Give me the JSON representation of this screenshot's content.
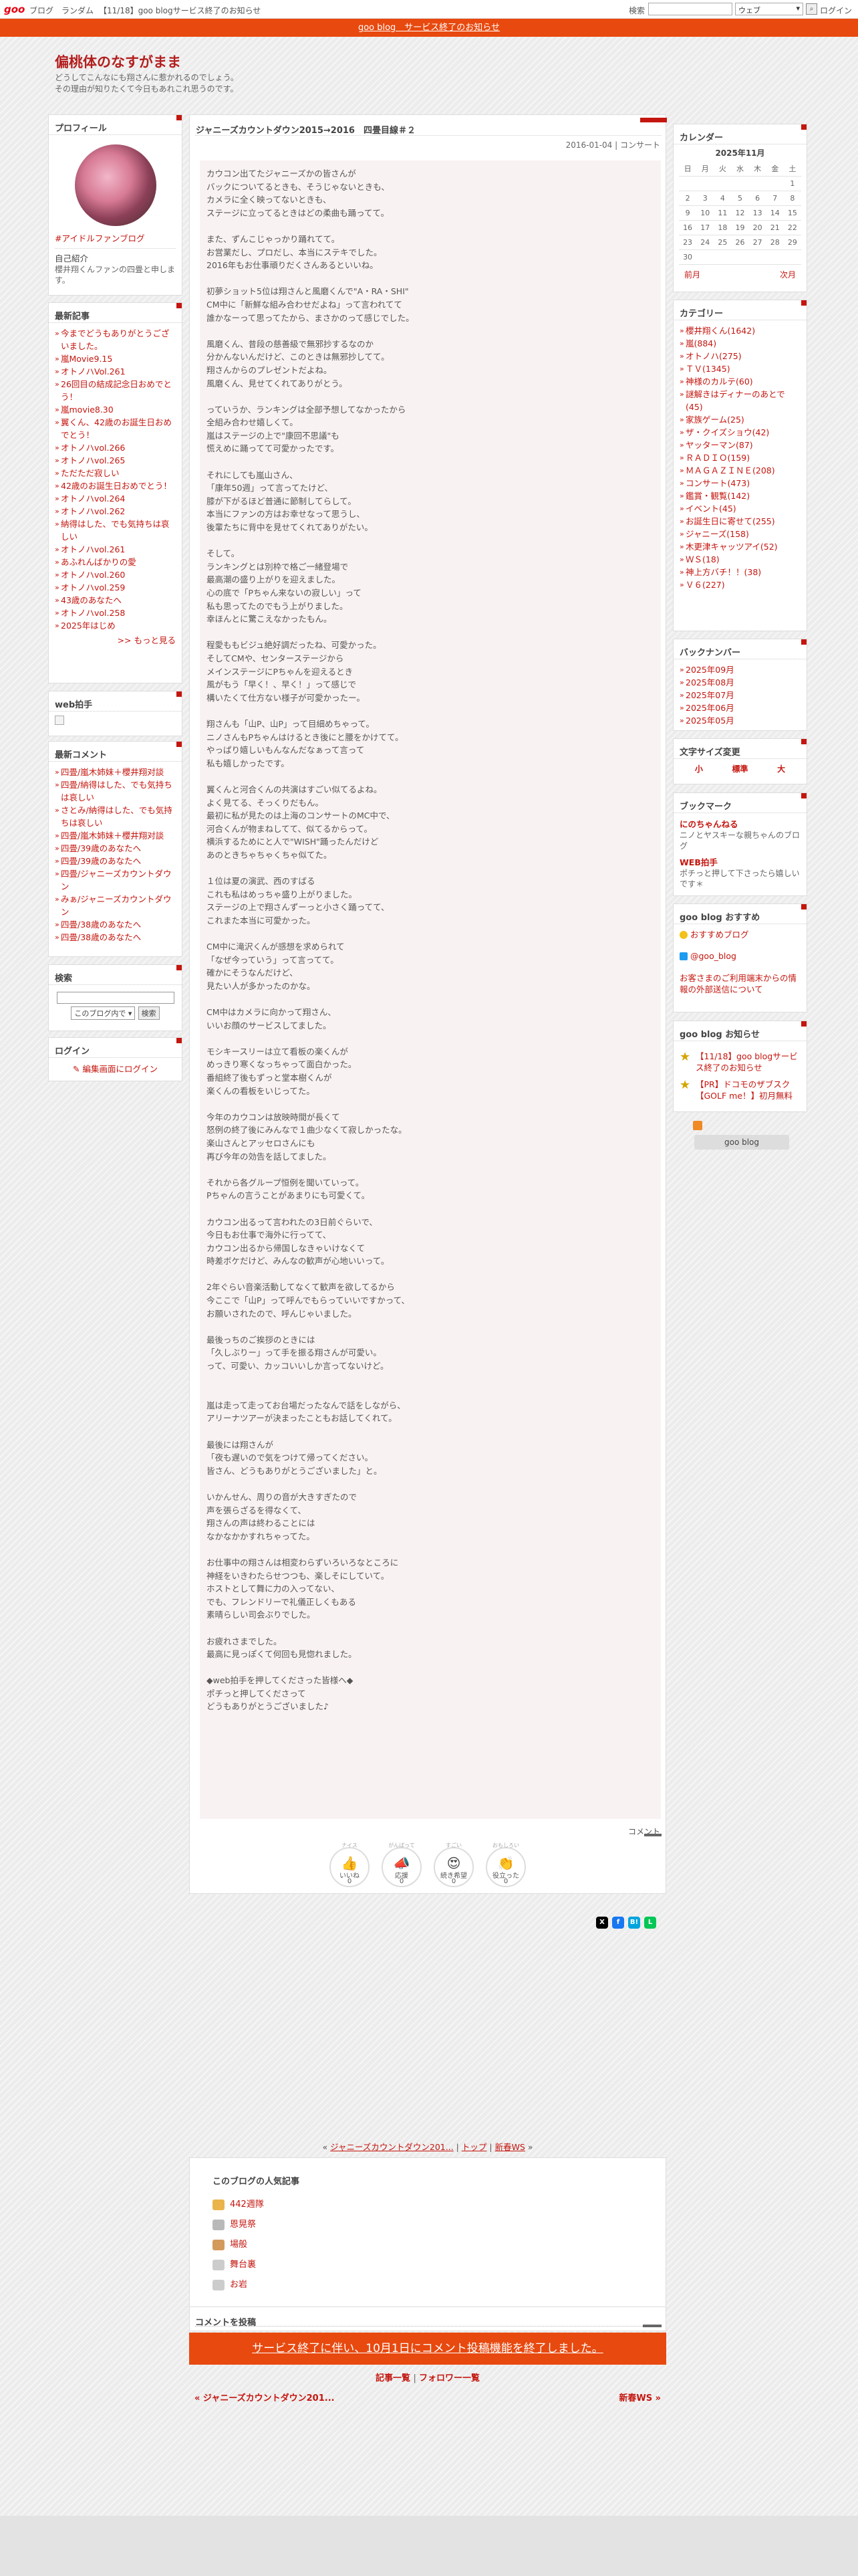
{
  "topbar": {
    "logo": "goo",
    "links": [
      "ブログ",
      "ランダム",
      "【11/18】goo blogサービス終了のお知らせ"
    ],
    "search_label": "検索",
    "search_select": "ウェブ",
    "login": "ログイン"
  },
  "notice": "goo blog　サービス終了のお知らせ",
  "blog": {
    "title": "偏桃体のなすがまま",
    "description": [
      "どうしてこんなにも翔さんに惹かれるのでしょう。",
      "その理由が知りたくて今日もあれこれ思うのです。"
    ]
  },
  "left": {
    "profile": {
      "header": "プロフィール",
      "category_link": "#アイドルファンブログ",
      "intro_label": "自己紹介",
      "intro": "櫻井翔くんファンの四畳と申します。"
    },
    "recent": {
      "header": "最新記事",
      "items": [
        "今までどうもありがとうございました。",
        "嵐Movie9.15",
        "オトノハVol.261",
        "26回目の結成記念日おめでとう！",
        "嵐movie8.30",
        "翼くん、42歳のお誕生日おめでとう！",
        "オトノハvol.266",
        "オトノハvol.265",
        "ただただ寂しい",
        "42歳のお誕生日おめでとう！",
        "オトノハvol.264",
        "オトノハvol.262",
        "納得はした、でも気持ちは哀しい",
        "オトノハvol.261",
        "あふれんばかりの愛",
        "オトノハvol.260",
        "オトノハvol.259",
        "43歳のあなたへ",
        "オトノハvol.258",
        "2025年はじめ"
      ],
      "more": ">> もっと見る"
    },
    "web_clap": {
      "header": "web拍手"
    },
    "recent_comments": {
      "header": "最新コメント",
      "items": [
        "四畳/嵐木姉妹＋櫻井翔对談",
        "四畳/納得はした、でも気持ちは哀しい",
        "さとみ/納得はした、でも気持ちは哀しい",
        "四畳/嵐木姉妹＋櫻井翔对談",
        "四畳/39歳のあなたへ",
        "四畳/39歳のあなたへ",
        "四畳/ジャニーズカウントダウン",
        "みぁ/ジャニーズカウントダウン",
        "四畳/38歳のあなたへ",
        "四畳/38歳のあなたへ"
      ]
    },
    "search": {
      "header": "検索",
      "scope": "このブログ内で",
      "button": "検索"
    },
    "login": {
      "header": "ログイン",
      "link": "編集画面にログイン"
    }
  },
  "entry": {
    "title": "ジャニーズカウントダウン2015→2016　四畳目線＃２",
    "meta": "2016-01-04 | コンサート",
    "body": "カウコン出てたジャニーズかの皆さんが\nバックについてるときも、そうじゃないときも、\nカメラに全く映ってないときも、\nステージに立ってるときはどの柔曲も踊ってて。\n\nまた、ずんこじゃっかり踊れてて。\nお営業だし、プロだし、本当にステキでした。\n2016年もお仕事頑りだくさんあるといいね。\n\n初夢ショット5位は翔さんと風磨くんで\"A・RA・SHI\"\nCM中に「新鮮な組み合わせだよね」って言われてて\n誰かなーって思ってたから、まさかのって感じでした。\n\n風磨くん、昔段の慈善級で無邪抄するなのか\n分かんないんだけど、このときは無邪抄してて。\n翔さんからのプレゼントだよね。\n風磨くん、見せてくれてありがとう。\n\nっていうか、ランキングは全部予想してなかったから\n全組み合わせ嬉しくて。\n嵐はステージの上で\"康回不思議\"も\n慌えめに踊ってて可愛かったです。\n\nそれにしても嵐山さん、\n「康年50週」って言ってたけど、\n膝が下がるほど普通に節制してらして。\n本当にファンの方はお幸せなって思うし、\n後輩たちに背中を見せてくれてありがたい。\n\nそして。\nランキングとは別枠で格ご一緒登場で\n最高潮の盛り上がりを迎えました。\n心の底で「Pちゃん来ないの寂しい」って\n私も思ってたのでもう上がりました。\n幸ほんとに驚こえなかったもん。\n\n程愛ももビジュ絶好調だったね、可愛かった。\nそしてCMや、センターステージから\nメインステージにPちゃんを迎えるとき\n風がもう「早く！、早く！」って感じで\n構いたくて仕方ない様子が可愛かったー。\n\n翔さんも「山P、山P」って目細めちゃって。\nニノさんもPちゃんはけるとき後にと腰をかけてて。\nやっぱり嬉しいもんなんだなぁって言って\n私も嬉しかったです。\n\n翼くんと河合くんの共演はすごい似てるよね。\nよく見てる、そっくりだもん。\n最初に私が見たのは上海のコンサートのMC中で、\n河合くんが物まねしてて、似てるからって。\n横浜するためにと人で\"WISH\"踊ったんだけど\nあのときちゃちゃくちゃ似てた。\n\n１位は夏の演武、西のすばる\nこれも私はめっちゃ盛り上がりました。\nステージの上で翔さんずーっと小さく踊ってて、\nこれまた本当に可愛かった。\n\nCM中に滝沢くんが感想を求められて\n「なぜ今っていう」って言ってて。\n確かにそうなんだけど、\n見たい人が多かったのかな。\n\nCM中はカメラに向かって翔さん、\nいいお顔のサービスしてました。\n\nモシキースリーは立て看板の楽くんが\nめっきり寒くなっちゃって面白かった。\n番組終了後もずっと堂本樹くんが\n楽くんの看板をいじってた。\n\n今年のカウコンは放映時間が長くて\n怒例の終了後にみんなで１曲少なくて寂しかったな。\n楽山さんとアッセロさんにも\n再び今年の効告を話してました。\n\nそれから各グループ恒例を聞いていって。\nPちゃんの言うことがあまりにも可愛くて。\n\nカウコン出るって言われたの3日前ぐらいで、\n今日もお仕事で海外に行ってて、\nカウコン出るから帰国しなきゃいけなくて\n時差ボケだけど、みんなの歓声が心地いいって。\n\n2年ぐらい音楽活動してなくて歓声を欲してるから\n今ここで「山P」って呼んでもらっていいですかって、\nお願いされたので、呼んじゃいました。\n\n最後っちのご挨拶のときには\n「久しぶりー」って手を振る翔さんが可愛い。\nって、可愛い、カッコいいしか言ってないけど。\n\n\n嵐は走って走ってお台場だったなんで話をしながら、\nアリーナツアーが決まったこともお話してくれて。\n\n最後には翔さんが\n「夜も遅いので気をつけて帰ってください。\n皆さん、どうもありがとうございました」と。\n\nいかんせん、周りの音が大きすぎたので\n声を張らざるを得なくて、\n翔さんの声は終わることには\nなかなかかすれちゃってた。\n\nお仕事中の翔さんは相変わらずいろいろなところに\n神経をいきわたらせつつも、楽しそにしていて。\nホストとして舞に力の入ってない、\nでも、フレンドリーで礼儀正しくもある\n素晴らしい司会ぶりでした。\n\nお疲れさまでした。\n最高に見っぽくて何回も見惚れました。\n\n◆web拍手を押してくださった皆様へ◆\nポチっと押してくださって\nどうもありがとうございました♪",
    "comment_link": "コメント",
    "reactions": [
      {
        "small": "ナイス",
        "label": "いいね",
        "count": "0",
        "icon": "thumbs-up-icon",
        "glyph": "👍"
      },
      {
        "small": "がんばって",
        "label": "応援",
        "count": "0",
        "icon": "megaphone-icon",
        "glyph": "📣"
      },
      {
        "small": "すごい",
        "label": "続き希望",
        "count": "0",
        "icon": "star-eyes-icon",
        "glyph": "😍"
      },
      {
        "small": "おもしろい",
        "label": "役立った",
        "count": "0",
        "icon": "clap-icon",
        "glyph": "👏"
      }
    ],
    "share": [
      {
        "label": "X",
        "color": "#000000"
      },
      {
        "label": "f",
        "color": "#1877f2"
      },
      {
        "label": "B!",
        "color": "#00a4de"
      },
      {
        "label": "L",
        "color": "#06c755"
      }
    ]
  },
  "right": {
    "calendar": {
      "header": "カレンダー",
      "month": "2025年11月",
      "weekdays": [
        "日",
        "月",
        "火",
        "水",
        "木",
        "金",
        "土"
      ],
      "weeks": [
        [
          "",
          "",
          "",
          "",
          "",
          "",
          "1"
        ],
        [
          "2",
          "3",
          "4",
          "5",
          "6",
          "7",
          "8"
        ],
        [
          "9",
          "10",
          "11",
          "12",
          "13",
          "14",
          "15"
        ],
        [
          "16",
          "17",
          "18",
          "19",
          "20",
          "21",
          "22"
        ],
        [
          "23",
          "24",
          "25",
          "26",
          "27",
          "28",
          "29"
        ],
        [
          "30",
          "",
          "",
          "",
          "",
          "",
          ""
        ]
      ],
      "prev": "前月",
      "next": "次月"
    },
    "categories": {
      "header": "カテゴリー",
      "items": [
        "櫻井翔くん(1642)",
        "嵐(884)",
        "オトノハ(275)",
        "ＴＶ(1345)",
        "神様のカルテ(60)",
        "謎解きはディナーのあとで(45)",
        "家族ゲーム(25)",
        "ザ・クイズショウ(42)",
        "ヤッターマン(87)",
        "ＲＡＤＩＯ(159)",
        "ＭＡＧＡＺＩＮＥ(208)",
        "コンサート(473)",
        "鑑賞・観覧(142)",
        "イベント(45)",
        "お誕生日に寄せて(255)",
        "ジャニーズ(158)",
        "木更津キャッツアイ(52)",
        "ＷＳ(18)",
        "神上方バチ！！(38)",
        "Ｖ６(227)"
      ]
    },
    "backnumber": {
      "header": "バックナンバー",
      "items": [
        "2025年09月",
        "2025年08月",
        "2025年07月",
        "2025年06月",
        "2025年05月"
      ]
    },
    "fontsize": {
      "header": "文字サイズ変更",
      "options": [
        "小",
        "標準",
        "大"
      ]
    },
    "bookmark": {
      "header": "ブックマーク",
      "items": [
        {
          "title": "にのちゃんねる",
          "desc": "ニノとヤスキーな親ちゃんのブログ"
        },
        {
          "title": "WEB拍手",
          "desc": "ポチっと押して下さったら嬉しいです＊"
        }
      ]
    },
    "goo_recommend": {
      "header": "goo blog おすすめ",
      "items": [
        "おすすめブログ",
        "@goo_blog"
      ],
      "note": "お客さまのご利用端末からの情報の外部送信について"
    },
    "goo_news": {
      "header": "goo blog お知らせ",
      "items": [
        "【11/18】goo blogサービス終了のお知らせ",
        "【PR】ドコモのザブスク【GOLF me！】初月無料"
      ]
    },
    "footer_pill": "goo blog"
  },
  "lower": {
    "pager": {
      "prev": "ジャニーズカウントダウン201...",
      "sep": "|",
      "top": "トップ",
      "next": "新春WS"
    },
    "popular": {
      "header": "このブログの人気記事",
      "items": [
        "442週隊",
        "恩晃祭",
        "場般",
        "舞台裏",
        "お岩"
      ]
    },
    "post_header": "コメントを投稿",
    "closed": "サービス終了に伴い、10月1日にコメント投稿機能を終了しました。",
    "links": [
      "記事一覧",
      "フォロワー一覧"
    ],
    "prev": "« ジャニーズカウントダウン201...",
    "next": "新春WS »"
  }
}
